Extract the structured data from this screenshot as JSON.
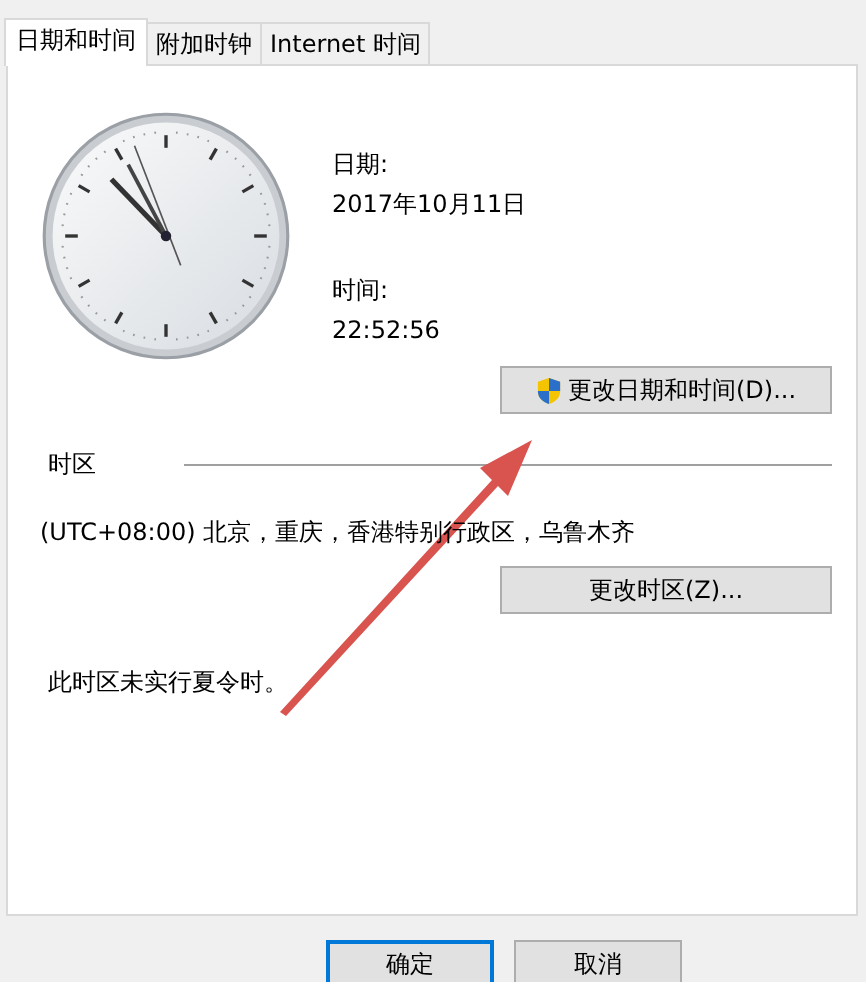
{
  "tabs": [
    {
      "label": "日期和时间",
      "selected": true
    },
    {
      "label": "附加时钟",
      "selected": false
    },
    {
      "label": "Internet 时间",
      "selected": false
    }
  ],
  "date": {
    "label": "日期:",
    "value": "2017年10月11日"
  },
  "time": {
    "label": "时间:",
    "value": "22:52:56"
  },
  "change_datetime_button": {
    "label": "更改日期和时间(D)...",
    "shield": true
  },
  "timezone": {
    "heading": "时区",
    "value": "(UTC+08:00) 北京，重庆，香港特别行政区，乌鲁木齐",
    "button": "更改时区(Z)...",
    "dst_note": "此时区未实行夏令时。"
  },
  "buttons": [
    {
      "label": "确定",
      "default": true
    },
    {
      "label": "取消",
      "default": false
    }
  ]
}
